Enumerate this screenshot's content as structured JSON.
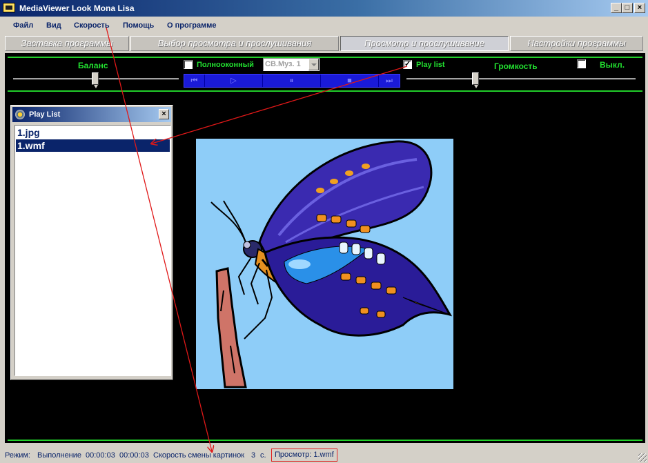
{
  "window": {
    "title": "MediaViewer Look Mona Lisa",
    "controls": [
      "_",
      "□",
      "×"
    ]
  },
  "menu": [
    "Файл",
    "Вид",
    "Скорость",
    "Помощь",
    "О программе"
  ],
  "tabs": [
    {
      "label": "Заставка программы",
      "active": false
    },
    {
      "label": "Выбор просмотра и прослушивания",
      "active": false
    },
    {
      "label": "Просмотр и прослушивание",
      "active": true
    },
    {
      "label": "Настройки программы",
      "active": false
    }
  ],
  "controls": {
    "balance_label": "Баланс",
    "fullscreen_label": "Полнооконный",
    "fullscreen_checked": false,
    "preset_value": "СВ.Муз. 1",
    "playlist_label": "Play list",
    "playlist_checked": true,
    "volume_label": "Громкость",
    "off_label": "Выкл.",
    "off_checked": false
  },
  "player_buttons": [
    "prev",
    "play",
    "pause",
    "stop",
    "next"
  ],
  "playlist_window": {
    "title": "Play List",
    "close": "×",
    "items": [
      {
        "label": "1.jpg",
        "selected": false
      },
      {
        "label": "1.wmf",
        "selected": true
      }
    ]
  },
  "status": {
    "mode_label": "Режим:",
    "mode_value": "Выполнение",
    "time_elapsed": "00:00:03",
    "time_total": "00:00:03",
    "speed_label": "Скорость смены картинок",
    "speed_value": "3",
    "speed_unit": "с.",
    "preview": "Просмотр: 1.wmf"
  },
  "colors": {
    "panel_bg": "#000000",
    "accent_green": "#22d02a",
    "annotation_red": "#e01818",
    "image_bg": "#8ecdf8"
  }
}
